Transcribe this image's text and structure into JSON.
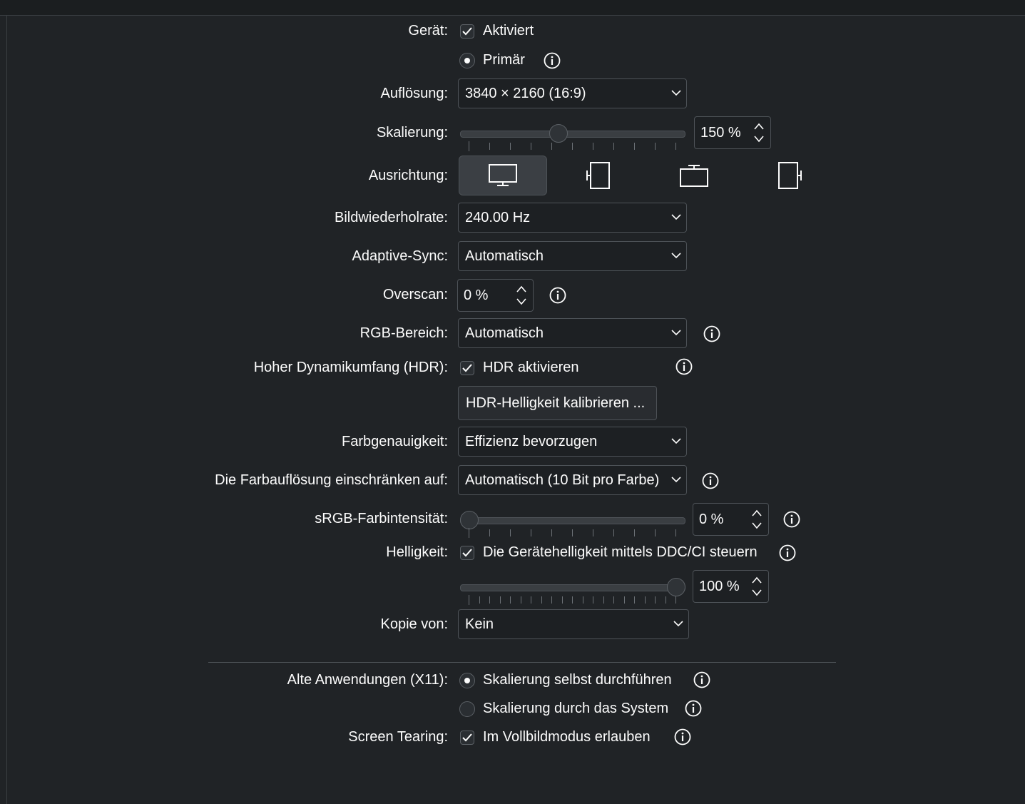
{
  "labels": {
    "device": "Gerät:",
    "resolution": "Auflösung:",
    "scaling": "Skalierung:",
    "orientation": "Ausrichtung:",
    "refresh": "Bildwiederholrate:",
    "adaptive_sync": "Adaptive-Sync:",
    "overscan": "Overscan:",
    "rgb_range": "RGB-Bereich:",
    "hdr": "Hoher Dynamikumfang (HDR):",
    "color_accuracy": "Farbgenauigkeit:",
    "color_depth": "Die Farbauflösung einschränken auf:",
    "srgb": "sRGB-Farbintensität:",
    "brightness": "Helligkeit:",
    "copy_of": "Kopie von:",
    "legacy": "Alte Anwendungen (X11):",
    "tearing": "Screen Tearing:"
  },
  "device": {
    "enabled_label": "Aktiviert",
    "enabled": true,
    "primary_label": "Primär",
    "primary": true
  },
  "resolution": {
    "value": "3840 × 2160 (16:9)"
  },
  "scaling": {
    "value": "150 %",
    "fraction": 0.43
  },
  "orientation": {
    "options": [
      "landscape-icon",
      "portrait-left-icon",
      "landscape-flipped-icon",
      "portrait-right-icon"
    ],
    "selected": 0
  },
  "refresh": {
    "value": "240.00 Hz"
  },
  "adaptive_sync": {
    "value": "Automatisch"
  },
  "overscan": {
    "value": "0 %"
  },
  "rgb_range": {
    "value": "Automatisch"
  },
  "hdr": {
    "enable_label": "HDR aktivieren",
    "enabled": true,
    "calibrate_label": "HDR-Helligkeit kalibrieren ..."
  },
  "color_accuracy": {
    "value": "Effizienz bevorzugen"
  },
  "color_depth": {
    "value": "Automatisch (10 Bit pro Farbe)"
  },
  "srgb": {
    "value": "0 %",
    "fraction": 0.0
  },
  "brightness": {
    "ddc_label": "Die Gerätehelligkeit mittels DDC/CI steuern",
    "ddc": true,
    "value": "100 %",
    "fraction": 1.0
  },
  "copy_of": {
    "value": "Kein"
  },
  "legacy": {
    "option1": "Skalierung selbst durchführen",
    "option2": "Skalierung durch das System",
    "selected": 1
  },
  "tearing": {
    "label": "Im Vollbildmodus erlauben",
    "enabled": true
  },
  "colors": {
    "background": "#202326",
    "field": "#1d2023",
    "border": "#4d5257",
    "text": "#fcfcfc"
  }
}
